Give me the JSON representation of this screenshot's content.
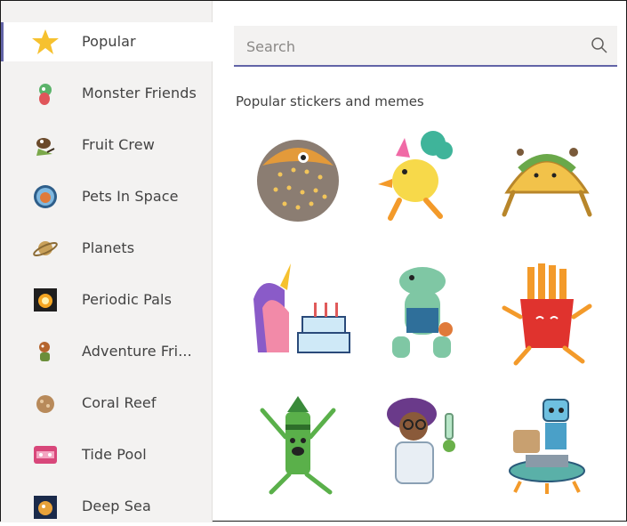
{
  "sidebar": {
    "items": [
      {
        "label": "Popular",
        "icon": "star-icon",
        "active": true
      },
      {
        "label": "Monster Friends",
        "icon": "monster-friends-icon"
      },
      {
        "label": "Fruit Crew",
        "icon": "fruit-crew-icon"
      },
      {
        "label": "Pets In Space",
        "icon": "pets-in-space-icon"
      },
      {
        "label": "Planets",
        "icon": "planet-icon"
      },
      {
        "label": "Periodic Pals",
        "icon": "periodic-pals-icon"
      },
      {
        "label": "Adventure Fri...",
        "icon": "adventure-friends-icon"
      },
      {
        "label": "Coral Reef",
        "icon": "coral-reef-icon"
      },
      {
        "label": "Tide Pool",
        "icon": "tide-pool-icon"
      },
      {
        "label": "Deep Sea",
        "icon": "deep-sea-icon"
      }
    ]
  },
  "search": {
    "placeholder": "Search",
    "value": ""
  },
  "main": {
    "section_title": "Popular stickers and memes",
    "stickers": [
      "pufferfish-sticker",
      "duck-with-broccoli-sticker",
      "taco-sticker",
      "unicorn-birthday-cake-sticker",
      "dinosaur-sticker",
      "french-fries-sticker",
      "crayon-sticker",
      "scientist-sticker",
      "robot-sticker"
    ]
  },
  "colors": {
    "accent": "#6264a7",
    "sidebar_bg": "#f3f2f1",
    "text": "#424242"
  }
}
